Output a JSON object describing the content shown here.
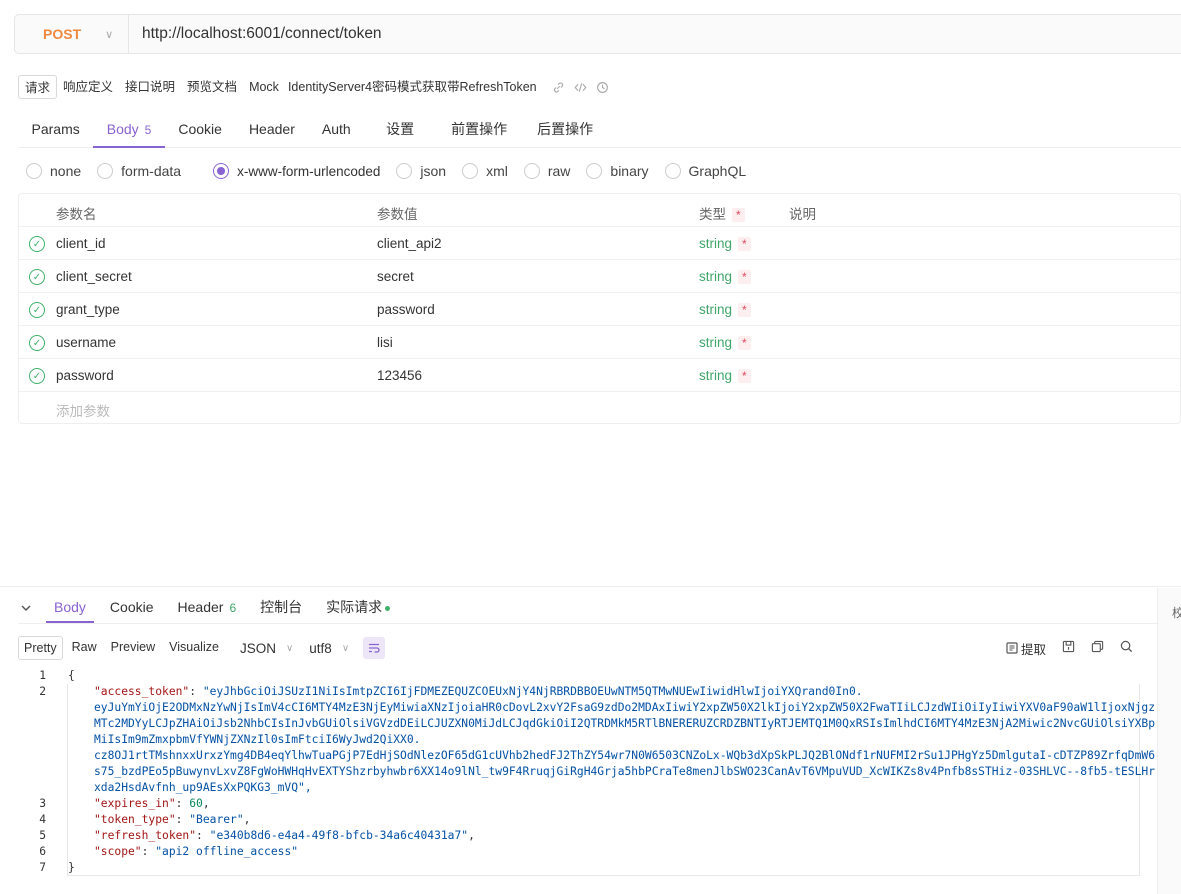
{
  "request": {
    "method": "POST",
    "url": "http://localhost:6001/connect/token"
  },
  "subtabs": [
    "请求",
    "响应定义",
    "接口说明",
    "预览文档",
    "Mock"
  ],
  "api_name": "IdentityServer4密码模式获取带RefreshToken",
  "req_tabs": [
    {
      "label": "Params"
    },
    {
      "label": "Body",
      "count": "5"
    },
    {
      "label": "Cookie"
    },
    {
      "label": "Header"
    },
    {
      "label": "Auth"
    },
    {
      "label": "设置"
    },
    {
      "label": "前置操作"
    },
    {
      "label": "后置操作"
    }
  ],
  "body_types": [
    "none",
    "form-data",
    "x-www-form-urlencoded",
    "json",
    "xml",
    "raw",
    "binary",
    "GraphQL"
  ],
  "body_type_selected": "x-www-form-urlencoded",
  "params": {
    "headers": {
      "name": "参数名",
      "value": "参数值",
      "type": "类型",
      "desc": "说明"
    },
    "rows": [
      {
        "name": "client_id",
        "value": "client_api2",
        "type": "string"
      },
      {
        "name": "client_secret",
        "value": "secret",
        "type": "string"
      },
      {
        "name": "grant_type",
        "value": "password",
        "type": "string"
      },
      {
        "name": "username",
        "value": "lisi",
        "type": "string"
      },
      {
        "name": "password",
        "value": "123456",
        "type": "string"
      }
    ],
    "add_placeholder": "添加参数"
  },
  "response": {
    "tabs": [
      {
        "label": "Body"
      },
      {
        "label": "Cookie"
      },
      {
        "label": "Header",
        "count": "6"
      },
      {
        "label": "控制台"
      },
      {
        "label": "实际请求"
      }
    ],
    "views": [
      "Pretty",
      "Raw",
      "Preview",
      "Visualize"
    ],
    "format": "JSON",
    "encoding": "utf8",
    "extract_label": "提取",
    "right_label": "校"
  },
  "code": {
    "l1": "{",
    "access_token_key": "\"access_token\"",
    "access_token_parts": [
      "\"eyJhbGciOiJSUzI1NiIsImtpZCI6IjFDMEZEQUZCOEUxNjY4NjRBRDBBOEUwNTM5QTMwNUEwIiwidHlwIjoiYXQrand0In0.",
      "eyJuYmYiOjE2ODMxNzYwNjIsImV4cCI6MTY4MzE3NjEyMiwiaXNzIjoiaHR0cDovL2xvY2FsaG9zdDo2MDAxIiwiY2xpZW50X2lkIjoiY2xpZW50X2FwaTIiLCJzdWIiOiIyIiwiYXV0aF90aW1lIjoxNjgz",
      "MTc2MDYyLCJpZHAiOiJsb2NhbCIsInJvbGUiOlsiVGVzdDEiLCJUZXN0MiJdLCJqdGkiOiI2QTRDMkM5RTlBNERERUZCRDZBNTIyRTJEMTQ1M0QxRSIsImlhdCI6MTY4MzE3NjA2Miwic2NvcGUiOlsiYXBp",
      "MiIsIm9mZmxpbmVfYWNjZXNzIl0sImFtciI6WyJwd2QiXX0.",
      "cz8OJ1rtTMshnxxUrxzYmg4DB4eqYlhwTuaPGjP7EdHjSOdNlezOF65dG1cUVhb2hedFJ2ThZY54wr7N0W6503CNZoLx-WQb3dXpSkPLJQ2BlONdf1rNUFMI2rSu1JPHgYz5DmlgutaI-cDTZP89ZrfqDmW6",
      "s75_bzdPEo5pBuwynvLxvZ8FgWoHWHqHvEXTYShzrbyhwbr6XX14o9lNl_tw9F4RruqjGiRgH4Grja5hbPCraTe8menJlbSWO23CanAvT6VMpuVUD_XcWIKZs8v4Pnfb8sSTHiz-03SHLVC--8fb5-tESLHr",
      "xda2HsdAvfnh_up9AEsXxPQKG3_mVQ\","
    ],
    "expires_key": "\"expires_in\"",
    "expires_val": "60",
    "token_type_key": "\"token_type\"",
    "token_type_val": "\"Bearer\"",
    "refresh_key": "\"refresh_token\"",
    "refresh_val": "\"e340b8d6-e4a4-49f8-bfcb-34a6c40431a7\"",
    "scope_key": "\"scope\"",
    "scope_val": "\"api2 offline_access\"",
    "l7": "}"
  },
  "colors": {
    "accent": "#8a63d2",
    "method": "#f0883e",
    "success": "#3fb06a",
    "required": "#e5495e"
  }
}
